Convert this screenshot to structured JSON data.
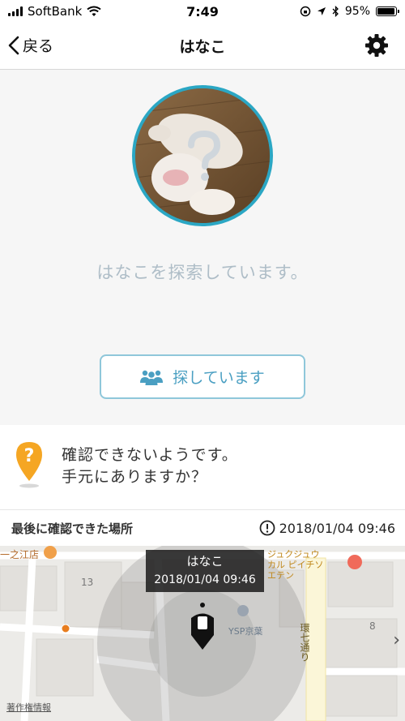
{
  "status_bar": {
    "carrier": "SoftBank",
    "time": "7:49",
    "battery": "95%",
    "battery_level": 0.95,
    "icons": [
      "signal-icon",
      "wifi-icon",
      "rotation-lock-icon",
      "location-icon",
      "bluetooth-icon",
      "battery-icon"
    ]
  },
  "nav": {
    "back_label": "戻る",
    "title": "はなこ",
    "settings_icon": "gear-icon"
  },
  "profile": {
    "search_message": "はなこを探索しています。",
    "search_button_label": "探しています",
    "search_button_icon": "people-icon",
    "accent_color": "#2ba7c4"
  },
  "notice": {
    "icon": "question-pin-icon",
    "line1": "確認できないようです。",
    "line2": "手元にありますか？",
    "pin_color": "#f5a623"
  },
  "last_seen": {
    "label": "最後に確認できた場所",
    "timestamp": "2018/01/04 09:46",
    "icon": "alert-circle-icon"
  },
  "map": {
    "popup_name": "はなこ",
    "popup_time": "2018/01/04 09:46",
    "labels": {
      "store": "一之江店",
      "block_13": "13",
      "building": "ジュクジュウカル ピイチソエテン",
      "ysp": "YSP京葉",
      "street": "環七通り",
      "block_8": "8"
    },
    "copyright": "著作権情報",
    "next_icon": "chevron-right-icon"
  }
}
